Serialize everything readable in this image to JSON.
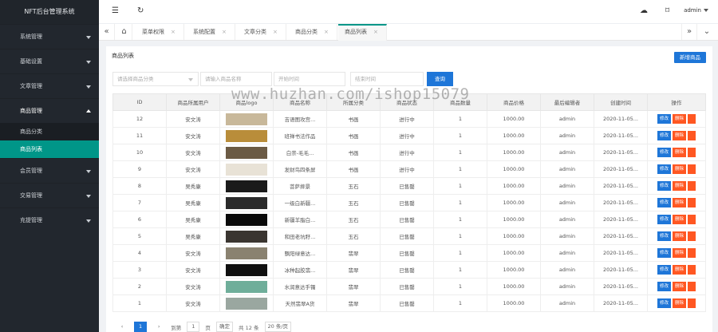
{
  "sidebar": {
    "logo": "NFT后台管理系统",
    "items": [
      {
        "label": "系统管理",
        "open": false
      },
      {
        "label": "基础设置",
        "open": false
      },
      {
        "label": "文章管理",
        "open": false
      },
      {
        "label": "商品管理",
        "open": true
      },
      {
        "label": "会员管理",
        "open": false
      },
      {
        "label": "交易管理",
        "open": false
      },
      {
        "label": "充提管理",
        "open": false
      }
    ],
    "submenu": [
      {
        "label": "商品分类",
        "active": false
      },
      {
        "label": "商品列表",
        "active": true
      }
    ]
  },
  "header": {
    "menu_icon": "☰",
    "refresh_icon": "↻",
    "cloud_icon": "☁",
    "tag_icon": "⌑",
    "user": "admin"
  },
  "tabs": {
    "prev": "«",
    "home": "⌂",
    "next": "»",
    "dropdown": "⌄",
    "items": [
      {
        "label": "菜单权限"
      },
      {
        "label": "系统配置"
      },
      {
        "label": "文章分类"
      },
      {
        "label": "商品分类"
      },
      {
        "label": "商品列表"
      }
    ],
    "close": "×"
  },
  "panel": {
    "title": "商品列表",
    "add_button": "新增商品",
    "filters": {
      "category_placeholder": "请选择商品分类",
      "name_placeholder": "请输入商品名称",
      "start_placeholder": "开始时间",
      "end_placeholder": "结束时间",
      "query_button": "查询"
    }
  },
  "table": {
    "headers": [
      "ID",
      "商品所属用户",
      "商品logo",
      "商品名称",
      "所属分类",
      "商品状态",
      "商品数量",
      "商品价格",
      "最后编辑者",
      "创建时间",
      "操作"
    ],
    "edit_label": "修改",
    "delete_label": "删除",
    "rows": [
      {
        "id": "12",
        "user": "安文涛",
        "name": "吉语图攻宫...",
        "category": "书画",
        "status": "进行中",
        "qty": "1",
        "price": "1000.00",
        "editor": "admin",
        "created": "2020-11-05..."
      },
      {
        "id": "11",
        "user": "安文涛",
        "name": "班禅书法作品",
        "category": "书画",
        "status": "进行中",
        "qty": "1",
        "price": "1000.00",
        "editor": "admin",
        "created": "2020-11-05..."
      },
      {
        "id": "10",
        "user": "安文涛",
        "name": "白崇-毛毛...",
        "category": "书画",
        "status": "进行中",
        "qty": "1",
        "price": "1000.00",
        "editor": "admin",
        "created": "2020-11-05..."
      },
      {
        "id": "9",
        "user": "安文涛",
        "name": "发财鸟四条屏",
        "category": "书画",
        "status": "进行中",
        "qty": "1",
        "price": "1000.00",
        "editor": "admin",
        "created": "2020-11-05..."
      },
      {
        "id": "8",
        "user": "吴秀康",
        "name": "菩萨摔景",
        "category": "玉石",
        "status": "已售罄",
        "qty": "1",
        "price": "1000.00",
        "editor": "admin",
        "created": "2020-11-05..."
      },
      {
        "id": "7",
        "user": "吴秀康",
        "name": "一级白新疆...",
        "category": "玉石",
        "status": "已售罄",
        "qty": "1",
        "price": "1000.00",
        "editor": "admin",
        "created": "2020-11-05..."
      },
      {
        "id": "6",
        "user": "吴秀康",
        "name": "新疆羊脂白...",
        "category": "玉石",
        "status": "已售罄",
        "qty": "1",
        "price": "1000.00",
        "editor": "admin",
        "created": "2020-11-05..."
      },
      {
        "id": "5",
        "user": "吴秀康",
        "name": "和田老坑籽...",
        "category": "玉石",
        "status": "已售罄",
        "qty": "1",
        "price": "1000.00",
        "editor": "admin",
        "created": "2020-11-05..."
      },
      {
        "id": "4",
        "user": "安文涛",
        "name": "飘阳绿意达...",
        "category": "翡翠",
        "status": "已售罄",
        "qty": "1",
        "price": "1000.00",
        "editor": "admin",
        "created": "2020-11-05..."
      },
      {
        "id": "3",
        "user": "安文涛",
        "name": "冰种起胶翡...",
        "category": "翡翠",
        "status": "已售罄",
        "qty": "1",
        "price": "1000.00",
        "editor": "admin",
        "created": "2020-11-05..."
      },
      {
        "id": "2",
        "user": "安文涛",
        "name": "水润意达手镯",
        "category": "翡翠",
        "status": "已售罄",
        "qty": "1",
        "price": "1000.00",
        "editor": "admin",
        "created": "2020-11-05..."
      },
      {
        "id": "1",
        "user": "安文涛",
        "name": "天然翡翠A货",
        "category": "翡翠",
        "status": "已售罄",
        "qty": "1",
        "price": "1000.00",
        "editor": "admin",
        "created": "2020-11-05..."
      }
    ],
    "thumb_colors": [
      "#c8b89a",
      "#b98d3a",
      "#6b5a44",
      "#e8e2d6",
      "#1a1a1a",
      "#2a2a2a",
      "#0a0a0a",
      "#3a3530",
      "#8a8270",
      "#101010",
      "#6fae9a",
      "#9aa7a0"
    ]
  },
  "pager": {
    "prev": "‹",
    "current_page": "1",
    "next": "›",
    "goto_label": "到第",
    "page_input": "1",
    "page_unit": "页",
    "ok_label": "确定",
    "total": "共 12 条",
    "page_size": "20 条/页"
  },
  "watermark": "www.huzhan.com/ishop15079",
  "colors": {
    "sidebar_bg": "#22272e",
    "active_green": "#009688",
    "primary_blue": "#1e76d8",
    "danger_orange": "#ff5722"
  }
}
